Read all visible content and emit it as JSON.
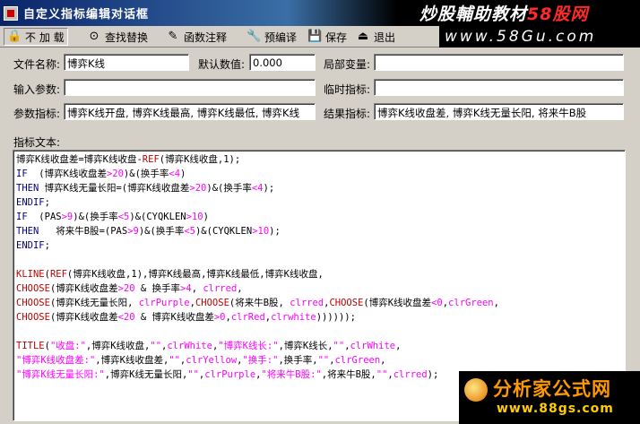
{
  "window": {
    "title": "自定义指标编辑对话框"
  },
  "watermarks": {
    "top": "炒股輔助教材",
    "top_brand": "58股网",
    "top_url": "www.58Gu.com",
    "bottom_name": "分析家公式网",
    "bottom_url": "www.88gs.com"
  },
  "toolbar": {
    "items": [
      {
        "label": "不 加 载",
        "icon": "lock-icon"
      },
      {
        "label": "查找替换",
        "icon": "binoculars-icon"
      },
      {
        "label": "函数注释",
        "icon": "pen-icon"
      },
      {
        "label": "预编译",
        "icon": "wrench-icon"
      },
      {
        "label": "保存",
        "icon": "floppy-disk-icon"
      },
      {
        "label": "退出",
        "icon": "exit-door-icon"
      }
    ]
  },
  "form": {
    "file_name_label": "文件名称:",
    "file_name_value": "博弈K线",
    "default_value_label": "默认数值:",
    "default_value_value": "0.000",
    "local_var_label": "局部变量:",
    "local_var_value": "",
    "input_param_label": "输入参数:",
    "input_param_value": "",
    "temp_indicator_label": "临时指标:",
    "temp_indicator_value": "",
    "param_indicator_label": "参数指标:",
    "param_indicator_value": "博弈K线开盘, 博弈K线最高, 博弈K线最低, 博弈K线",
    "result_indicator_label": "结果指标:",
    "result_indicator_value": "博弈K线收盘差, 博弈K线无量长阳, 将来牛B股",
    "formula_text_label": "指标文本:"
  },
  "code": [
    "博弈K线收盘差=博弈K线收盘-REF(博弈K线收盘,1);",
    "IF  (博弈K线收盘差>20)&(换手率<4)",
    "THEN 博弈K线无量长阳=(博弈K线收盘差>20)&(换手率<4);",
    "ENDIF;",
    "IF  (PAS>9)&(换手率<5)&(CYQKLEN>10)",
    "THEN   将来牛B股=(PAS>9)&(换手率<5)&(CYQKLEN>10);",
    "ENDIF;",
    "",
    "KLINE(REF(博弈K线收盘,1),博弈K线最高,博弈K线最低,博弈K线收盘,",
    "CHOOSE(博弈K线收盘差>20 & 换手率>4, clrred,",
    "CHOOSE(博弈K线无量长阳, clrPurple,CHOOSE(将来牛B股, clrred,CHOOSE(博弈K线收盘差<0,clrGreen,",
    "CHOOSE(博弈K线收盘差<20 & 博弈K线收盘差>0,clrRed,clrwhite))))));",
    "",
    "TITLE(\"收盘:\",博弈K线收盘,\"\",clrWhite,\"博弈K线长:\",博弈K线长,\"\",clrWhite,",
    "\"博弈K线收盘差:\",博弈K线收盘差,\"\",clrYellow,\"换手:\",换手率,\"\",clrGreen,",
    "\"博弈K线无量长阳:\",博弈K线无量长阳,\"\",clrPurple,\"将来牛B股:\",将来牛B股,\"\",clrred);"
  ]
}
